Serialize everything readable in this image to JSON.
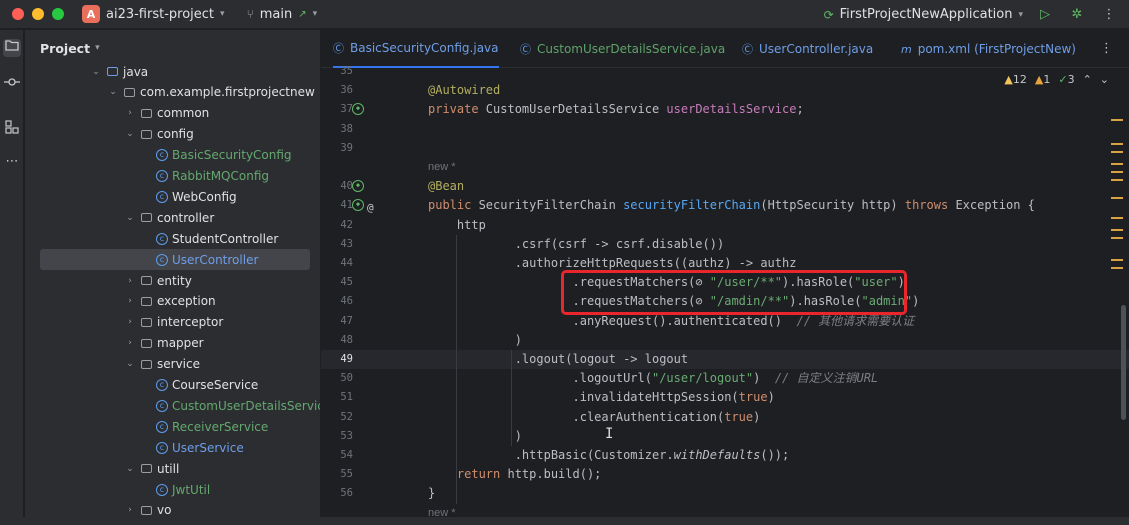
{
  "titlebar": {
    "project_initial": "A",
    "project_name": "ai23-first-project",
    "branch": "main",
    "run_config": "FirstProjectNewApplication"
  },
  "project_panel": {
    "title": "Project",
    "tree": [
      {
        "label": "java",
        "kind": "folder-blue",
        "indent": 0,
        "expanded": true
      },
      {
        "label": "com.example.firstprojectnew",
        "kind": "package",
        "indent": 1,
        "expanded": true
      },
      {
        "label": "common",
        "kind": "package",
        "indent": 2,
        "expanded": false
      },
      {
        "label": "config",
        "kind": "package",
        "indent": 2,
        "expanded": true
      },
      {
        "label": "BasicSecurityConfig",
        "kind": "class",
        "color": "green",
        "indent": 3
      },
      {
        "label": "RabbitMQConfig",
        "kind": "class",
        "color": "green",
        "indent": 3
      },
      {
        "label": "WebConfig",
        "kind": "class",
        "color": "normal",
        "indent": 3
      },
      {
        "label": "controller",
        "kind": "package",
        "indent": 2,
        "expanded": true
      },
      {
        "label": "StudentController",
        "kind": "class",
        "color": "normal",
        "indent": 3
      },
      {
        "label": "UserController",
        "kind": "class",
        "color": "blue",
        "indent": 3,
        "selected": true
      },
      {
        "label": "entity",
        "kind": "package",
        "indent": 2,
        "expanded": false
      },
      {
        "label": "exception",
        "kind": "package",
        "indent": 2,
        "expanded": false
      },
      {
        "label": "interceptor",
        "kind": "package",
        "indent": 2,
        "expanded": false
      },
      {
        "label": "mapper",
        "kind": "package",
        "indent": 2,
        "expanded": false
      },
      {
        "label": "service",
        "kind": "package",
        "indent": 2,
        "expanded": true
      },
      {
        "label": "CourseService",
        "kind": "class",
        "color": "normal",
        "indent": 3
      },
      {
        "label": "CustomUserDetailsService",
        "kind": "class",
        "color": "green",
        "indent": 3
      },
      {
        "label": "ReceiverService",
        "kind": "class",
        "color": "green",
        "indent": 3
      },
      {
        "label": "UserService",
        "kind": "class",
        "color": "blue",
        "indent": 3
      },
      {
        "label": "utill",
        "kind": "package",
        "indent": 2,
        "expanded": true
      },
      {
        "label": "JwtUtil",
        "kind": "class",
        "color": "green",
        "indent": 3
      },
      {
        "label": "vo",
        "kind": "package",
        "indent": 2,
        "expanded": false
      }
    ]
  },
  "tabs": [
    {
      "label": "BasicSecurityConfig.java",
      "style": "active",
      "icon": "class-icon"
    },
    {
      "label": "CustomUserDetailsService.java",
      "style": "green",
      "icon": "class-icon"
    },
    {
      "label": "UserController.java",
      "style": "blue",
      "icon": "class-icon"
    },
    {
      "label": "pom.xml (FirstProjectNew)",
      "style": "blue",
      "icon": "maven-icon"
    }
  ],
  "inspection": {
    "errors_warnings": "12",
    "weak_warnings": "1",
    "typos": "3"
  },
  "editor": {
    "lines": [
      {
        "n": "35",
        "parts": []
      },
      {
        "n": "36",
        "parts": [
          [
            "ann",
            "@Autowired"
          ]
        ]
      },
      {
        "n": "37",
        "gutter": "bean",
        "parts": [
          [
            "kw",
            "private "
          ],
          [
            "",
            "CustomUserDetailsService "
          ],
          [
            "fld",
            "userDetailsService"
          ],
          [
            "",
            ";"
          ]
        ]
      },
      {
        "n": "38",
        "parts": []
      },
      {
        "n": "39",
        "parts": []
      },
      {
        "n": "",
        "hint": "new *"
      },
      {
        "n": "40",
        "gutter": "bean",
        "parts": [
          [
            "ann",
            "@Bean"
          ]
        ]
      },
      {
        "n": "41",
        "gutter": "bean",
        "at": true,
        "parts": [
          [
            "kw",
            "public "
          ],
          [
            "",
            "SecurityFilterChain "
          ],
          [
            "fn",
            "securityFilterChain"
          ],
          [
            "",
            "(HttpSecurity http) "
          ],
          [
            "kw",
            "throws "
          ],
          [
            "",
            "Exception {"
          ]
        ]
      },
      {
        "n": "42",
        "parts": [
          [
            "",
            "    http"
          ]
        ]
      },
      {
        "n": "43",
        "parts": [
          [
            "",
            "            .csrf(csrf -> csrf.disable())"
          ]
        ]
      },
      {
        "n": "44",
        "parts": [
          [
            "",
            "            .authorizeHttpRequests((authz) -> authz"
          ]
        ]
      },
      {
        "n": "45",
        "parts": [
          [
            "",
            "                    .requestMatchers("
          ],
          [
            "",
            "⊘ "
          ],
          [
            "str",
            "\"/user/**\""
          ],
          [
            "",
            ").hasRole("
          ],
          [
            "str",
            "\"user\""
          ],
          [
            "",
            ")"
          ]
        ]
      },
      {
        "n": "46",
        "parts": [
          [
            "",
            "                    .requestMatchers("
          ],
          [
            "",
            "⊘ "
          ],
          [
            "str",
            "\"/amdin/**\""
          ],
          [
            "",
            ").hasRole("
          ],
          [
            "str",
            "\"admin\""
          ],
          [
            "",
            ")"
          ]
        ]
      },
      {
        "n": "47",
        "parts": [
          [
            "",
            "                    .anyRequest().authenticated()  "
          ],
          [
            "cmt",
            "// 其他请求需要认证"
          ]
        ]
      },
      {
        "n": "48",
        "parts": [
          [
            "",
            "            )"
          ]
        ]
      },
      {
        "n": "49",
        "current": true,
        "parts": [
          [
            "",
            "            .logout(logout -> logout"
          ]
        ]
      },
      {
        "n": "50",
        "parts": [
          [
            "",
            "                    .logoutUrl("
          ],
          [
            "str",
            "\"/user/logout\""
          ],
          [
            "",
            ")  "
          ],
          [
            "cmt",
            "// 自定义注销URL"
          ]
        ]
      },
      {
        "n": "51",
        "parts": [
          [
            "",
            "                    .invalidateHttpSession("
          ],
          [
            "kw",
            "true"
          ],
          [
            "",
            ")"
          ]
        ]
      },
      {
        "n": "52",
        "parts": [
          [
            "",
            "                    .clearAuthentication("
          ],
          [
            "kw",
            "true"
          ],
          [
            "",
            ")"
          ]
        ]
      },
      {
        "n": "53",
        "parts": [
          [
            "",
            "            )"
          ]
        ]
      },
      {
        "n": "54",
        "parts": [
          [
            "",
            "            .httpBasic(Customizer."
          ],
          [
            "ital",
            "withDefaults"
          ],
          [
            "",
            "());"
          ]
        ]
      },
      {
        "n": "55",
        "parts": [
          [
            "kw",
            "    return "
          ],
          [
            "",
            "http.build();"
          ]
        ]
      },
      {
        "n": "56",
        "parts": [
          [
            "",
            "}"
          ]
        ]
      },
      {
        "n": "",
        "hint": "new *"
      }
    ]
  },
  "colors": {
    "highlight_box": "#e8262b",
    "accent": "#3574f0"
  }
}
